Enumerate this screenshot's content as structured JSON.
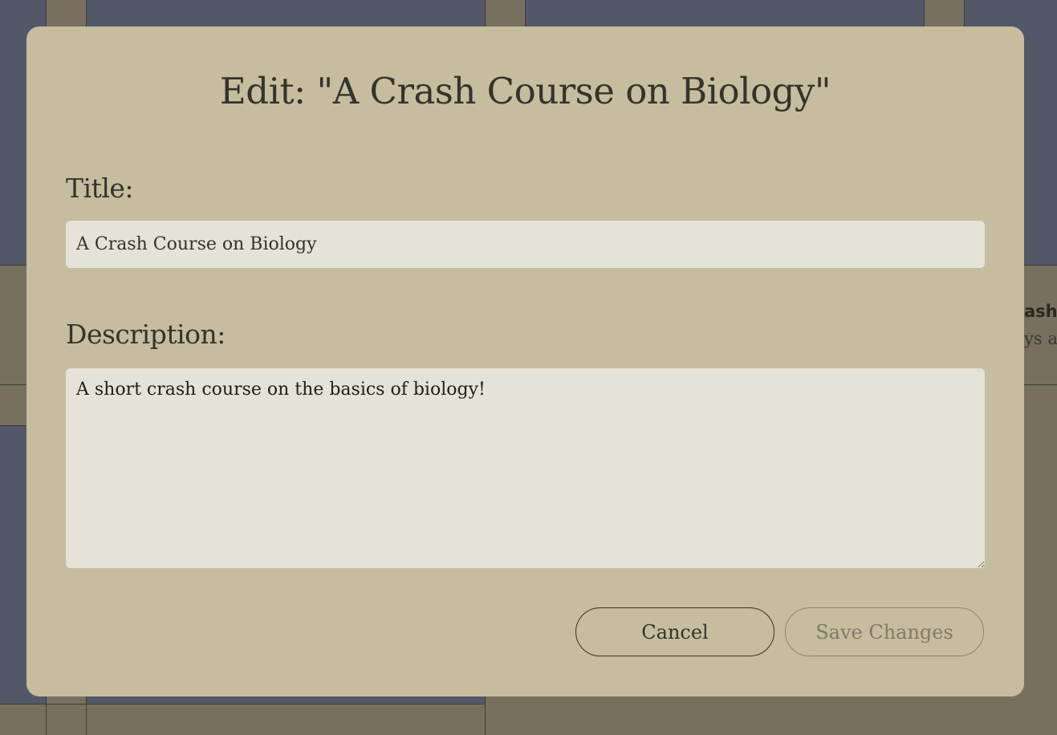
{
  "background": {
    "snippet_title": "ash",
    "snippet_text": "ys a"
  },
  "modal": {
    "heading": "Edit: \"A Crash Course on Biology\"",
    "title_label": "Title:",
    "title_value": "A Crash Course on Biology",
    "description_label": "Description:",
    "description_value": "A short crash course on the basics of biology!",
    "cancel_label": "Cancel",
    "save_label": "Save Changes"
  },
  "colors": {
    "modal_background": "#c6bd9e",
    "input_background": "#e5e2d7",
    "text": "#34332e",
    "disabled_text": "#7f7a6b",
    "overlay_panel": "#525868",
    "overlay_olive": "#78705e"
  }
}
